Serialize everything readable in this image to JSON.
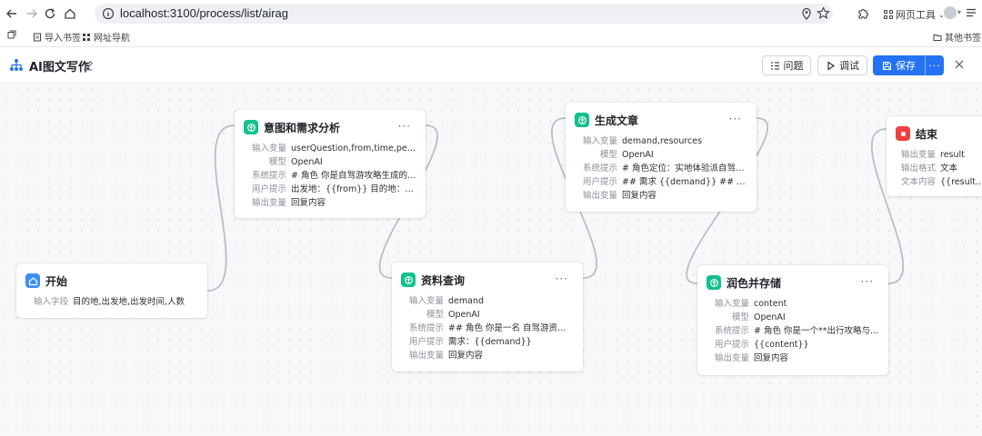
{
  "browser": {
    "url": "localhost:3100/process/list/airag",
    "web_tools_label": "网页工具",
    "bookmarks": [
      "导入书签",
      "网址导航"
    ],
    "other_bookmarks": "其他书签"
  },
  "header": {
    "title": "AI图文写作",
    "issue_label": "问题",
    "debug_label": "调试",
    "save_label": "保存",
    "more_label": "···"
  },
  "nodes": {
    "start": {
      "title": "开始",
      "icon": "home-icon",
      "color": "#3b8ef6",
      "rows": [
        {
          "label": "输入字段",
          "value": "目的地,出发地,出发时间,人数"
        }
      ]
    },
    "intent": {
      "title": "意图和需求分析",
      "icon": "gpt-icon",
      "color": "#13c08f",
      "rows": [
        {
          "label": "输入变量",
          "value": "userQuestion,from,time,people..."
        },
        {
          "label": "模型",
          "value": "OpenAI"
        },
        {
          "label": "系统提示",
          "value": "# 角色 你是自驾游攻略生成的需..."
        },
        {
          "label": "用户提示",
          "value": "出发地：{{from}} 目的地：{{user..."
        },
        {
          "label": "输出变量",
          "value": "回复内容"
        }
      ]
    },
    "query": {
      "title": "资料查询",
      "icon": "gpt-icon",
      "color": "#13c08f",
      "rows": [
        {
          "label": "输入变量",
          "value": "demand"
        },
        {
          "label": "模型",
          "value": "OpenAI"
        },
        {
          "label": "系统提示",
          "value": "## 角色 你是一名 自驾游资料查..."
        },
        {
          "label": "用户提示",
          "value": "需求：{{demand}}"
        },
        {
          "label": "输出变量",
          "value": "回复内容"
        }
      ]
    },
    "generate": {
      "title": "生成文章",
      "icon": "gpt-icon",
      "color": "#13c08f",
      "rows": [
        {
          "label": "输入变量",
          "value": "demand,resources"
        },
        {
          "label": "模型",
          "value": "OpenAI"
        },
        {
          "label": "系统提示",
          "value": "# 角色定位：实地体验派自驾游..."
        },
        {
          "label": "用户提示",
          "value": "## 需求 {{demand}} ## 资料 {{re..."
        },
        {
          "label": "输出变量",
          "value": "回复内容"
        }
      ]
    },
    "polish": {
      "title": "润色并存储",
      "icon": "gpt-icon",
      "color": "#13c08f",
      "rows": [
        {
          "label": "输入变量",
          "value": "content"
        },
        {
          "label": "模型",
          "value": "OpenAI"
        },
        {
          "label": "系统提示",
          "value": "# 角色   你是一个**出行攻略与..."
        },
        {
          "label": "用户提示",
          "value": "{{content}}"
        },
        {
          "label": "输出变量",
          "value": "回复内容"
        }
      ]
    },
    "end": {
      "title": "结束",
      "icon": "stop-icon",
      "color": "#f04040",
      "rows": [
        {
          "label": "输出变量",
          "value": "result"
        },
        {
          "label": "输出格式",
          "value": "文本"
        },
        {
          "label": "文本内容",
          "value": "{{result}}"
        }
      ]
    }
  },
  "colors": {
    "accent": "#2472f2",
    "edge": "#b9bec6"
  }
}
